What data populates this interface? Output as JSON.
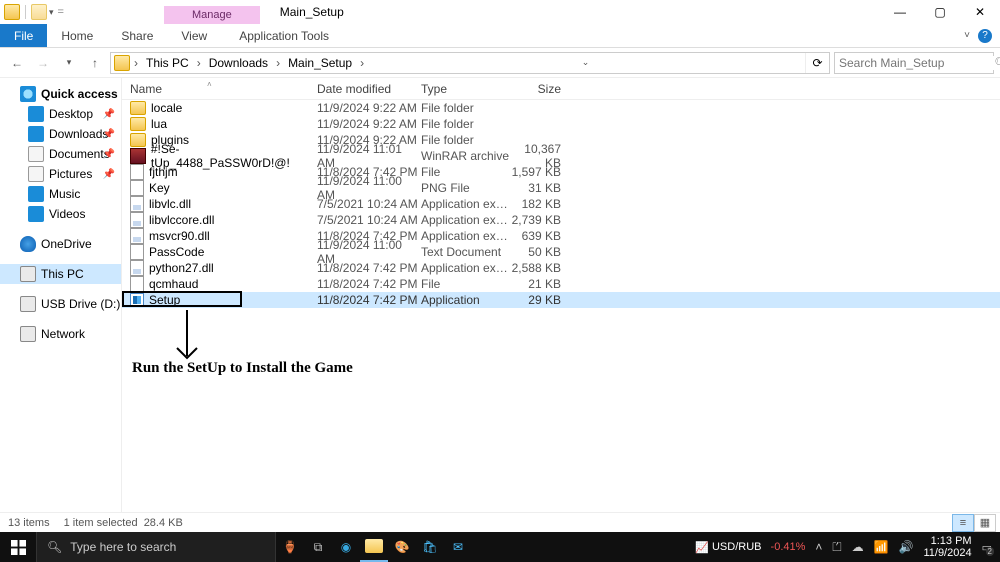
{
  "window": {
    "contextual_tab_label": "Manage",
    "title": "Main_Setup",
    "min": "—",
    "max": "▢",
    "close": "✕"
  },
  "ribbon": {
    "file": "File",
    "tabs": [
      "Home",
      "Share",
      "View"
    ],
    "contextual": "Application Tools"
  },
  "nav": {
    "breadcrumbs": [
      "This PC",
      "Downloads",
      "Main_Setup"
    ],
    "search_placeholder": "Search Main_Setup"
  },
  "sidebar": {
    "quick_access": "Quick access",
    "items": [
      {
        "label": "Desktop",
        "pin": true
      },
      {
        "label": "Downloads",
        "pin": true
      },
      {
        "label": "Documents",
        "pin": true
      },
      {
        "label": "Pictures",
        "pin": true
      },
      {
        "label": "Music"
      },
      {
        "label": "Videos"
      }
    ],
    "onedrive": "OneDrive",
    "this_pc": "This PC",
    "usb": "USB Drive (D:)",
    "network": "Network"
  },
  "columns": {
    "name": "Name",
    "date": "Date modified",
    "type": "Type",
    "size": "Size"
  },
  "files": [
    {
      "name": "locale",
      "date": "11/9/2024 9:22 AM",
      "type": "File folder",
      "size": "",
      "icon": "folder"
    },
    {
      "name": "lua",
      "date": "11/9/2024 9:22 AM",
      "type": "File folder",
      "size": "",
      "icon": "folder"
    },
    {
      "name": "plugins",
      "date": "11/9/2024 9:22 AM",
      "type": "File folder",
      "size": "",
      "icon": "folder"
    },
    {
      "name": "#!Se-tUp_4488_PaSSW0rD!@!",
      "date": "11/9/2024 11:01 AM",
      "type": "WinRAR archive",
      "size": "10,367 KB",
      "icon": "rar"
    },
    {
      "name": "fjthjm",
      "date": "11/8/2024 7:42 PM",
      "type": "File",
      "size": "1,597 KB",
      "icon": "file"
    },
    {
      "name": "Key",
      "date": "11/9/2024 11:00 AM",
      "type": "PNG File",
      "size": "31 KB",
      "icon": "png"
    },
    {
      "name": "libvlc.dll",
      "date": "7/5/2021 10:24 AM",
      "type": "Application exten...",
      "size": "182 KB",
      "icon": "dll"
    },
    {
      "name": "libvlccore.dll",
      "date": "7/5/2021 10:24 AM",
      "type": "Application exten...",
      "size": "2,739 KB",
      "icon": "dll"
    },
    {
      "name": "msvcr90.dll",
      "date": "11/8/2024 7:42 PM",
      "type": "Application exten...",
      "size": "639 KB",
      "icon": "dll"
    },
    {
      "name": "PassCode",
      "date": "11/9/2024 11:00 AM",
      "type": "Text Document",
      "size": "50 KB",
      "icon": "txt"
    },
    {
      "name": "python27.dll",
      "date": "11/8/2024 7:42 PM",
      "type": "Application exten...",
      "size": "2,588 KB",
      "icon": "dll"
    },
    {
      "name": "qcmhaud",
      "date": "11/8/2024 7:42 PM",
      "type": "File",
      "size": "21 KB",
      "icon": "file"
    },
    {
      "name": "Setup",
      "date": "11/8/2024 7:42 PM",
      "type": "Application",
      "size": "29 KB",
      "icon": "app",
      "selected": true
    }
  ],
  "annotation": "Run the SetUp to Install the Game",
  "status": {
    "items": "13 items",
    "selected": "1 item selected",
    "size": "28.4 KB"
  },
  "taskbar": {
    "search_placeholder": "Type here to search",
    "currency_pair": "USD/RUB",
    "currency_pct": "-0.41%",
    "time": "1:13 PM",
    "date": "11/9/2024",
    "notif": "2"
  }
}
